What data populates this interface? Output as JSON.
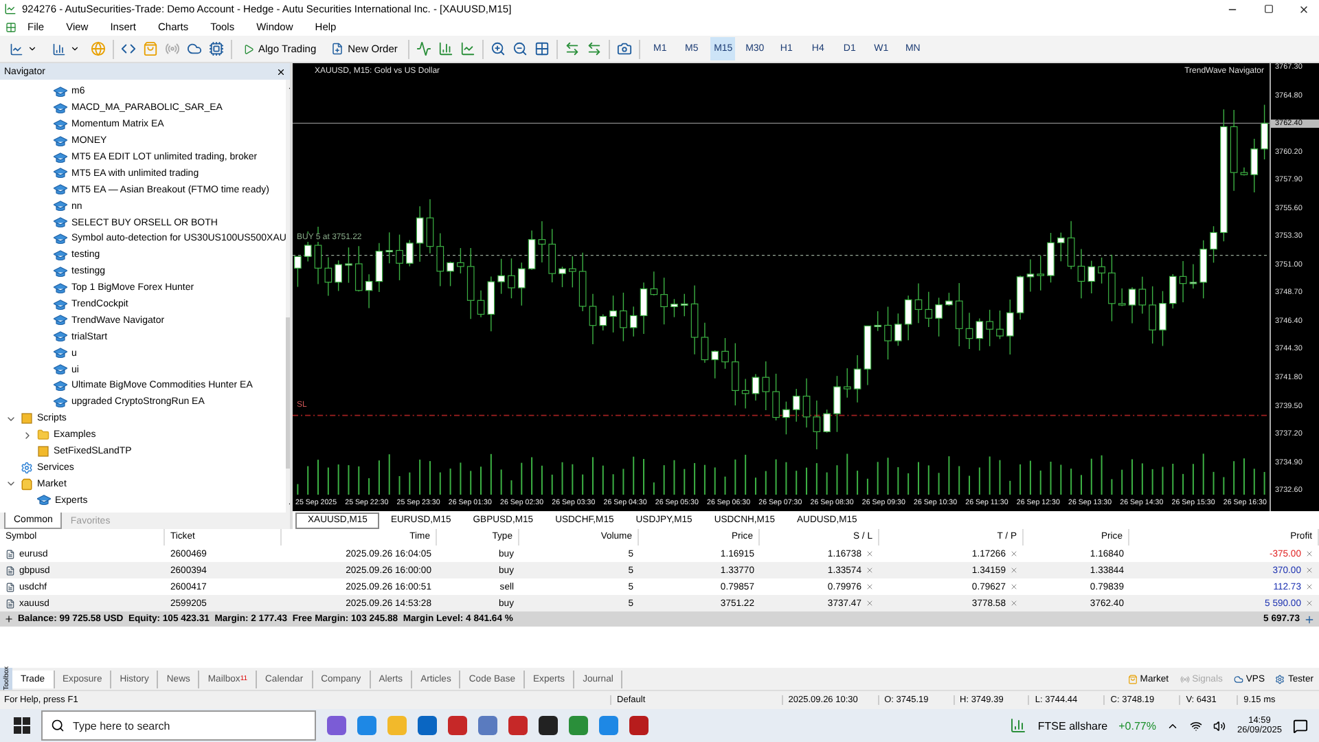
{
  "window": {
    "title": "924276 - AutuSecurities-Trade: Demo Account - Hedge - Autu Securities International Inc. - [XAUUSD,M15]"
  },
  "menu": [
    "File",
    "View",
    "Insert",
    "Charts",
    "Tools",
    "Window",
    "Help"
  ],
  "toolbar": {
    "buttons": [
      "Algo Trading",
      "New Order"
    ],
    "timeframes": [
      {
        "label": "M1",
        "selected": false
      },
      {
        "label": "M5",
        "selected": false
      },
      {
        "label": "M15",
        "selected": true
      },
      {
        "label": "M30",
        "selected": false
      },
      {
        "label": "H1",
        "selected": false
      },
      {
        "label": "H4",
        "selected": false
      },
      {
        "label": "D1",
        "selected": false
      },
      {
        "label": "W1",
        "selected": false
      },
      {
        "label": "MN",
        "selected": false
      }
    ]
  },
  "navigator": {
    "title": "Navigator",
    "expert_items": [
      "m6",
      "MACD_MA_PARABOLIC_SAR_EA",
      "Momentum Matrix EA",
      "MONEY",
      "MT5 EA EDIT LOT unlimited trading, broker",
      "MT5 EA with unlimited trading",
      "MT5 EA — Asian Breakout (FTMO time ready)",
      "nn",
      "SELECT BUY ORSELL OR BOTH",
      "Symbol auto-detection for US30US100US500XAU",
      "testing",
      "testingg",
      "Top 1 BigMove Forex Hunter",
      "TrendCockpit",
      "TrendWave Navigator",
      "trialStart",
      "u",
      "ui",
      "Ultimate BigMove Commodities Hunter EA",
      "upgraded CryptoStrongRun EA"
    ],
    "tree": [
      {
        "label": "Scripts",
        "kind": "script",
        "expanded": true,
        "children": [
          {
            "label": "Examples",
            "kind": "folder",
            "expanded": false
          },
          {
            "label": "SetFixedSLandTP",
            "kind": "script"
          }
        ]
      },
      {
        "label": "Services",
        "kind": "service"
      },
      {
        "label": "Market",
        "kind": "market",
        "expanded": true,
        "children": [
          {
            "label": "Experts",
            "kind": "expert"
          }
        ]
      }
    ],
    "tabs": [
      {
        "label": "Common",
        "selected": true
      },
      {
        "label": "Favorites",
        "selected": false
      }
    ]
  },
  "chart": {
    "title": "XAUUSD, M15:  Gold vs US Dollar",
    "indicator": "TrendWave Navigator",
    "order_label": "BUY 5 at 3751.22",
    "sl_label": "SL",
    "price_labels": [
      {
        "text": "3767.30",
        "current": false
      },
      {
        "text": "3764.80",
        "current": false
      },
      {
        "text": "3762.40",
        "current": true
      },
      {
        "text": "3760.20",
        "current": false
      },
      {
        "text": "3757.90",
        "current": false
      },
      {
        "text": "3755.60",
        "current": false
      },
      {
        "text": "3753.30",
        "current": false
      },
      {
        "text": "3751.00",
        "current": false
      },
      {
        "text": "3748.70",
        "current": false
      },
      {
        "text": "3746.40",
        "current": false
      },
      {
        "text": "3744.30",
        "current": false
      },
      {
        "text": "3741.80",
        "current": false
      },
      {
        "text": "3739.50",
        "current": false
      },
      {
        "text": "3737.20",
        "current": false
      },
      {
        "text": "3734.90",
        "current": false
      },
      {
        "text": "3732.60",
        "current": false
      }
    ],
    "time_labels": [
      "25 Sep 2025",
      "25 Sep 22:30",
      "25 Sep 23:30",
      "26 Sep 01:30",
      "26 Sep 02:30",
      "26 Sep 03:30",
      "26 Sep 04:30",
      "26 Sep 05:30",
      "26 Sep 06:30",
      "26 Sep 07:30",
      "26 Sep 08:30",
      "26 Sep 09:30",
      "26 Sep 10:30",
      "26 Sep 11:30",
      "26 Sep 12:30",
      "26 Sep 13:30",
      "26 Sep 14:30",
      "26 Sep 15:30",
      "26 Sep 16:30"
    ],
    "tabs": [
      {
        "label": "XAUUSD,M15",
        "selected": true
      },
      {
        "label": "EURUSD,M15",
        "selected": false
      },
      {
        "label": "GBPUSD,M15",
        "selected": false
      },
      {
        "label": "USDCHF,M15",
        "selected": false
      },
      {
        "label": "USDJPY,M15",
        "selected": false
      },
      {
        "label": "USDCNH,M15",
        "selected": false
      },
      {
        "label": "AUDUSD,M15",
        "selected": false
      }
    ]
  },
  "trade_table": {
    "columns": [
      "Symbol",
      "Ticket",
      "Time",
      "Type",
      "Volume",
      "Price",
      "S / L",
      "T / P",
      "Price",
      "Profit"
    ],
    "rows": [
      {
        "cells": [
          "eurusd",
          "2600469",
          "2025.09.26 16:04:05",
          "buy",
          "5",
          "1.16915",
          "1.16738",
          "1.17266",
          "1.16840",
          "-375.00"
        ],
        "color": "#e02020"
      },
      {
        "cells": [
          "gbpusd",
          "2600394",
          "2025.09.26 16:00:00",
          "buy",
          "5",
          "1.33770",
          "1.33574",
          "1.34159",
          "1.33844",
          "370.00"
        ],
        "color": "#1a2fb0"
      },
      {
        "cells": [
          "usdchf",
          "2600417",
          "2025.09.26 16:00:51",
          "sell",
          "5",
          "0.79857",
          "0.79976",
          "0.79627",
          "0.79839",
          "112.73"
        ],
        "color": "#1a2fb0"
      },
      {
        "cells": [
          "xauusd",
          "2599205",
          "2025.09.26 14:53:28",
          "buy",
          "5",
          "3751.22",
          "3737.47",
          "3778.58",
          "3762.40",
          "5 590.00"
        ],
        "color": "#1a2fb0"
      }
    ],
    "summary": "Balance: 99 725.58 USD  Equity: 105 423.31  Margin: 2 177.43  Free Margin: 103 245.88  Margin Level: 4 841.64 %",
    "total": "5 697.73"
  },
  "toolbox": {
    "side_label": "Toolbox",
    "tabs": [
      {
        "label": "Trade",
        "selected": true
      },
      {
        "label": "Exposure",
        "selected": false
      },
      {
        "label": "History",
        "selected": false
      },
      {
        "label": "News",
        "selected": false
      },
      {
        "label": "Mailbox",
        "selected": false,
        "badge": "11"
      },
      {
        "label": "Calendar",
        "selected": false
      },
      {
        "label": "Company",
        "selected": false
      },
      {
        "label": "Alerts",
        "selected": false
      },
      {
        "label": "Articles",
        "selected": false
      },
      {
        "label": "Code Base",
        "selected": false
      },
      {
        "label": "Experts",
        "selected": false
      },
      {
        "label": "Journal",
        "selected": false
      }
    ],
    "right_buttons": [
      {
        "label": "Market",
        "disabled": false
      },
      {
        "label": "Signals",
        "disabled": true
      },
      {
        "label": "VPS",
        "disabled": false
      },
      {
        "label": "Tester",
        "disabled": false
      }
    ]
  },
  "status_bar": {
    "help": "For Help, press F1",
    "profile": "Default",
    "fields": [
      "2025.09.26 10:30",
      "O: 3745.19",
      "H: 3749.39",
      "L: 3744.44",
      "C: 3748.19",
      "V: 6431"
    ],
    "ping": "9.15 ms"
  },
  "taskbar": {
    "search": {
      "placeholder": "Type here to search"
    },
    "ticker": "FTSE allshare",
    "change": "+0.77%",
    "time": "14:59",
    "date": "26/09/2025"
  }
}
